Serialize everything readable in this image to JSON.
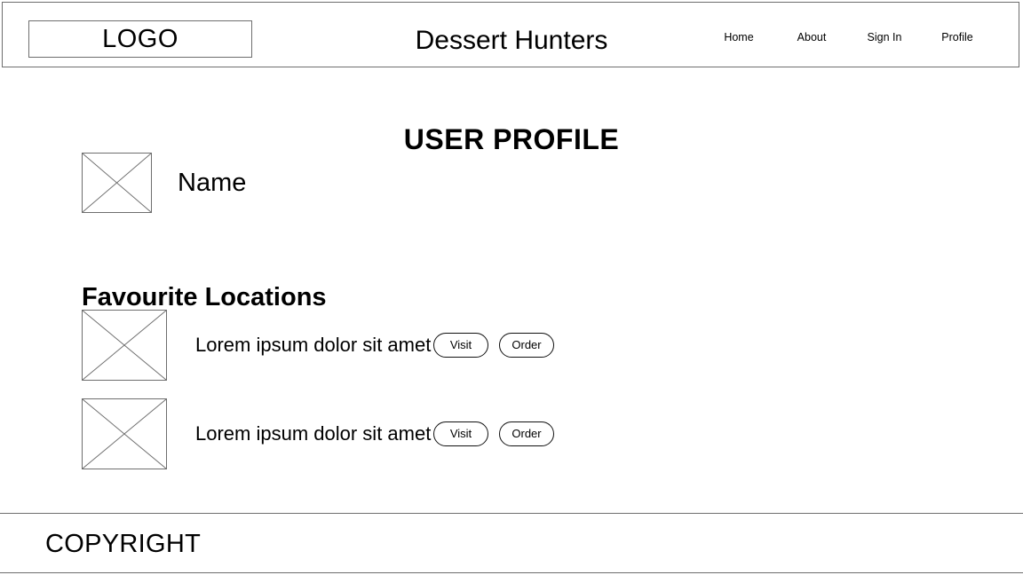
{
  "header": {
    "logo_label": "LOGO",
    "site_title": "Dessert Hunters",
    "nav": [
      {
        "label": "Home"
      },
      {
        "label": "About"
      },
      {
        "label": "Sign In"
      },
      {
        "label": "Profile"
      }
    ]
  },
  "main": {
    "page_title": "USER PROFILE",
    "profile": {
      "avatar_placeholder": "image-placeholder",
      "name": "Name"
    },
    "favourites": {
      "heading": "Favourite Locations",
      "items": [
        {
          "thumbnail_placeholder": "image-placeholder",
          "label": "Lorem ipsum dolor sit amet",
          "visit_label": "Visit",
          "order_label": "Order"
        },
        {
          "thumbnail_placeholder": "image-placeholder",
          "label": "Lorem ipsum dolor sit amet",
          "visit_label": "Visit",
          "order_label": "Order"
        }
      ]
    }
  },
  "footer": {
    "copyright": "COPYRIGHT"
  },
  "colors": {
    "border": "#6e6e6e",
    "button_border": "#111111",
    "text": "#000000",
    "background": "#ffffff"
  }
}
